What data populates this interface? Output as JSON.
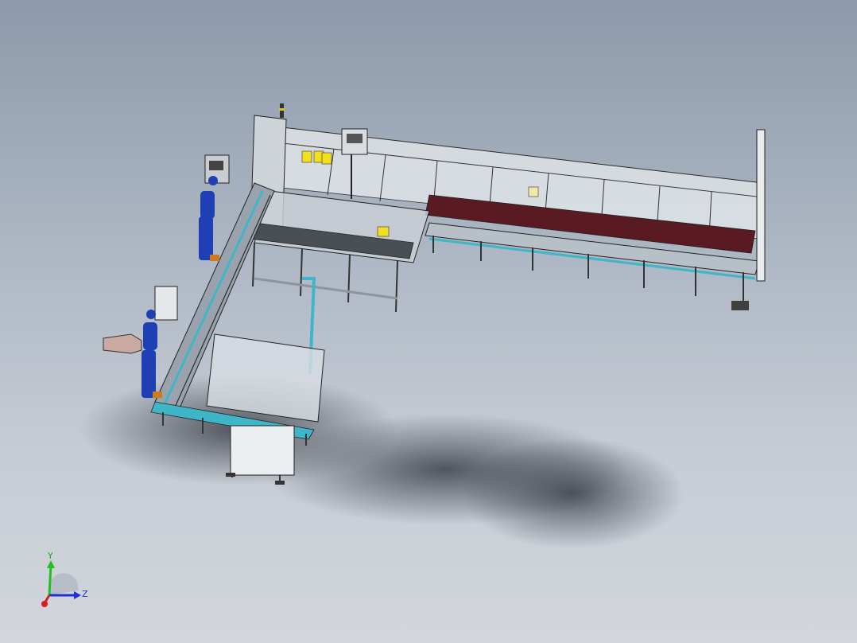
{
  "viewport": {
    "background_top": "#8c9aab",
    "background_bottom": "#d2d6dc"
  },
  "model": {
    "description_icon": "assembly-line-icon",
    "frame_color": "#9aa3ad",
    "conveyor_color": "#3fb6c8",
    "guard_color": "#d8dde3",
    "operator_color": "#1f3fb5",
    "part_color": "#f0e020",
    "belt_color": "#5a1a22"
  },
  "triad": {
    "x_label": "",
    "y_label": "Y",
    "z_label": "Z",
    "x_color": "#d62020",
    "y_color": "#20c020",
    "z_color": "#2030d0"
  }
}
